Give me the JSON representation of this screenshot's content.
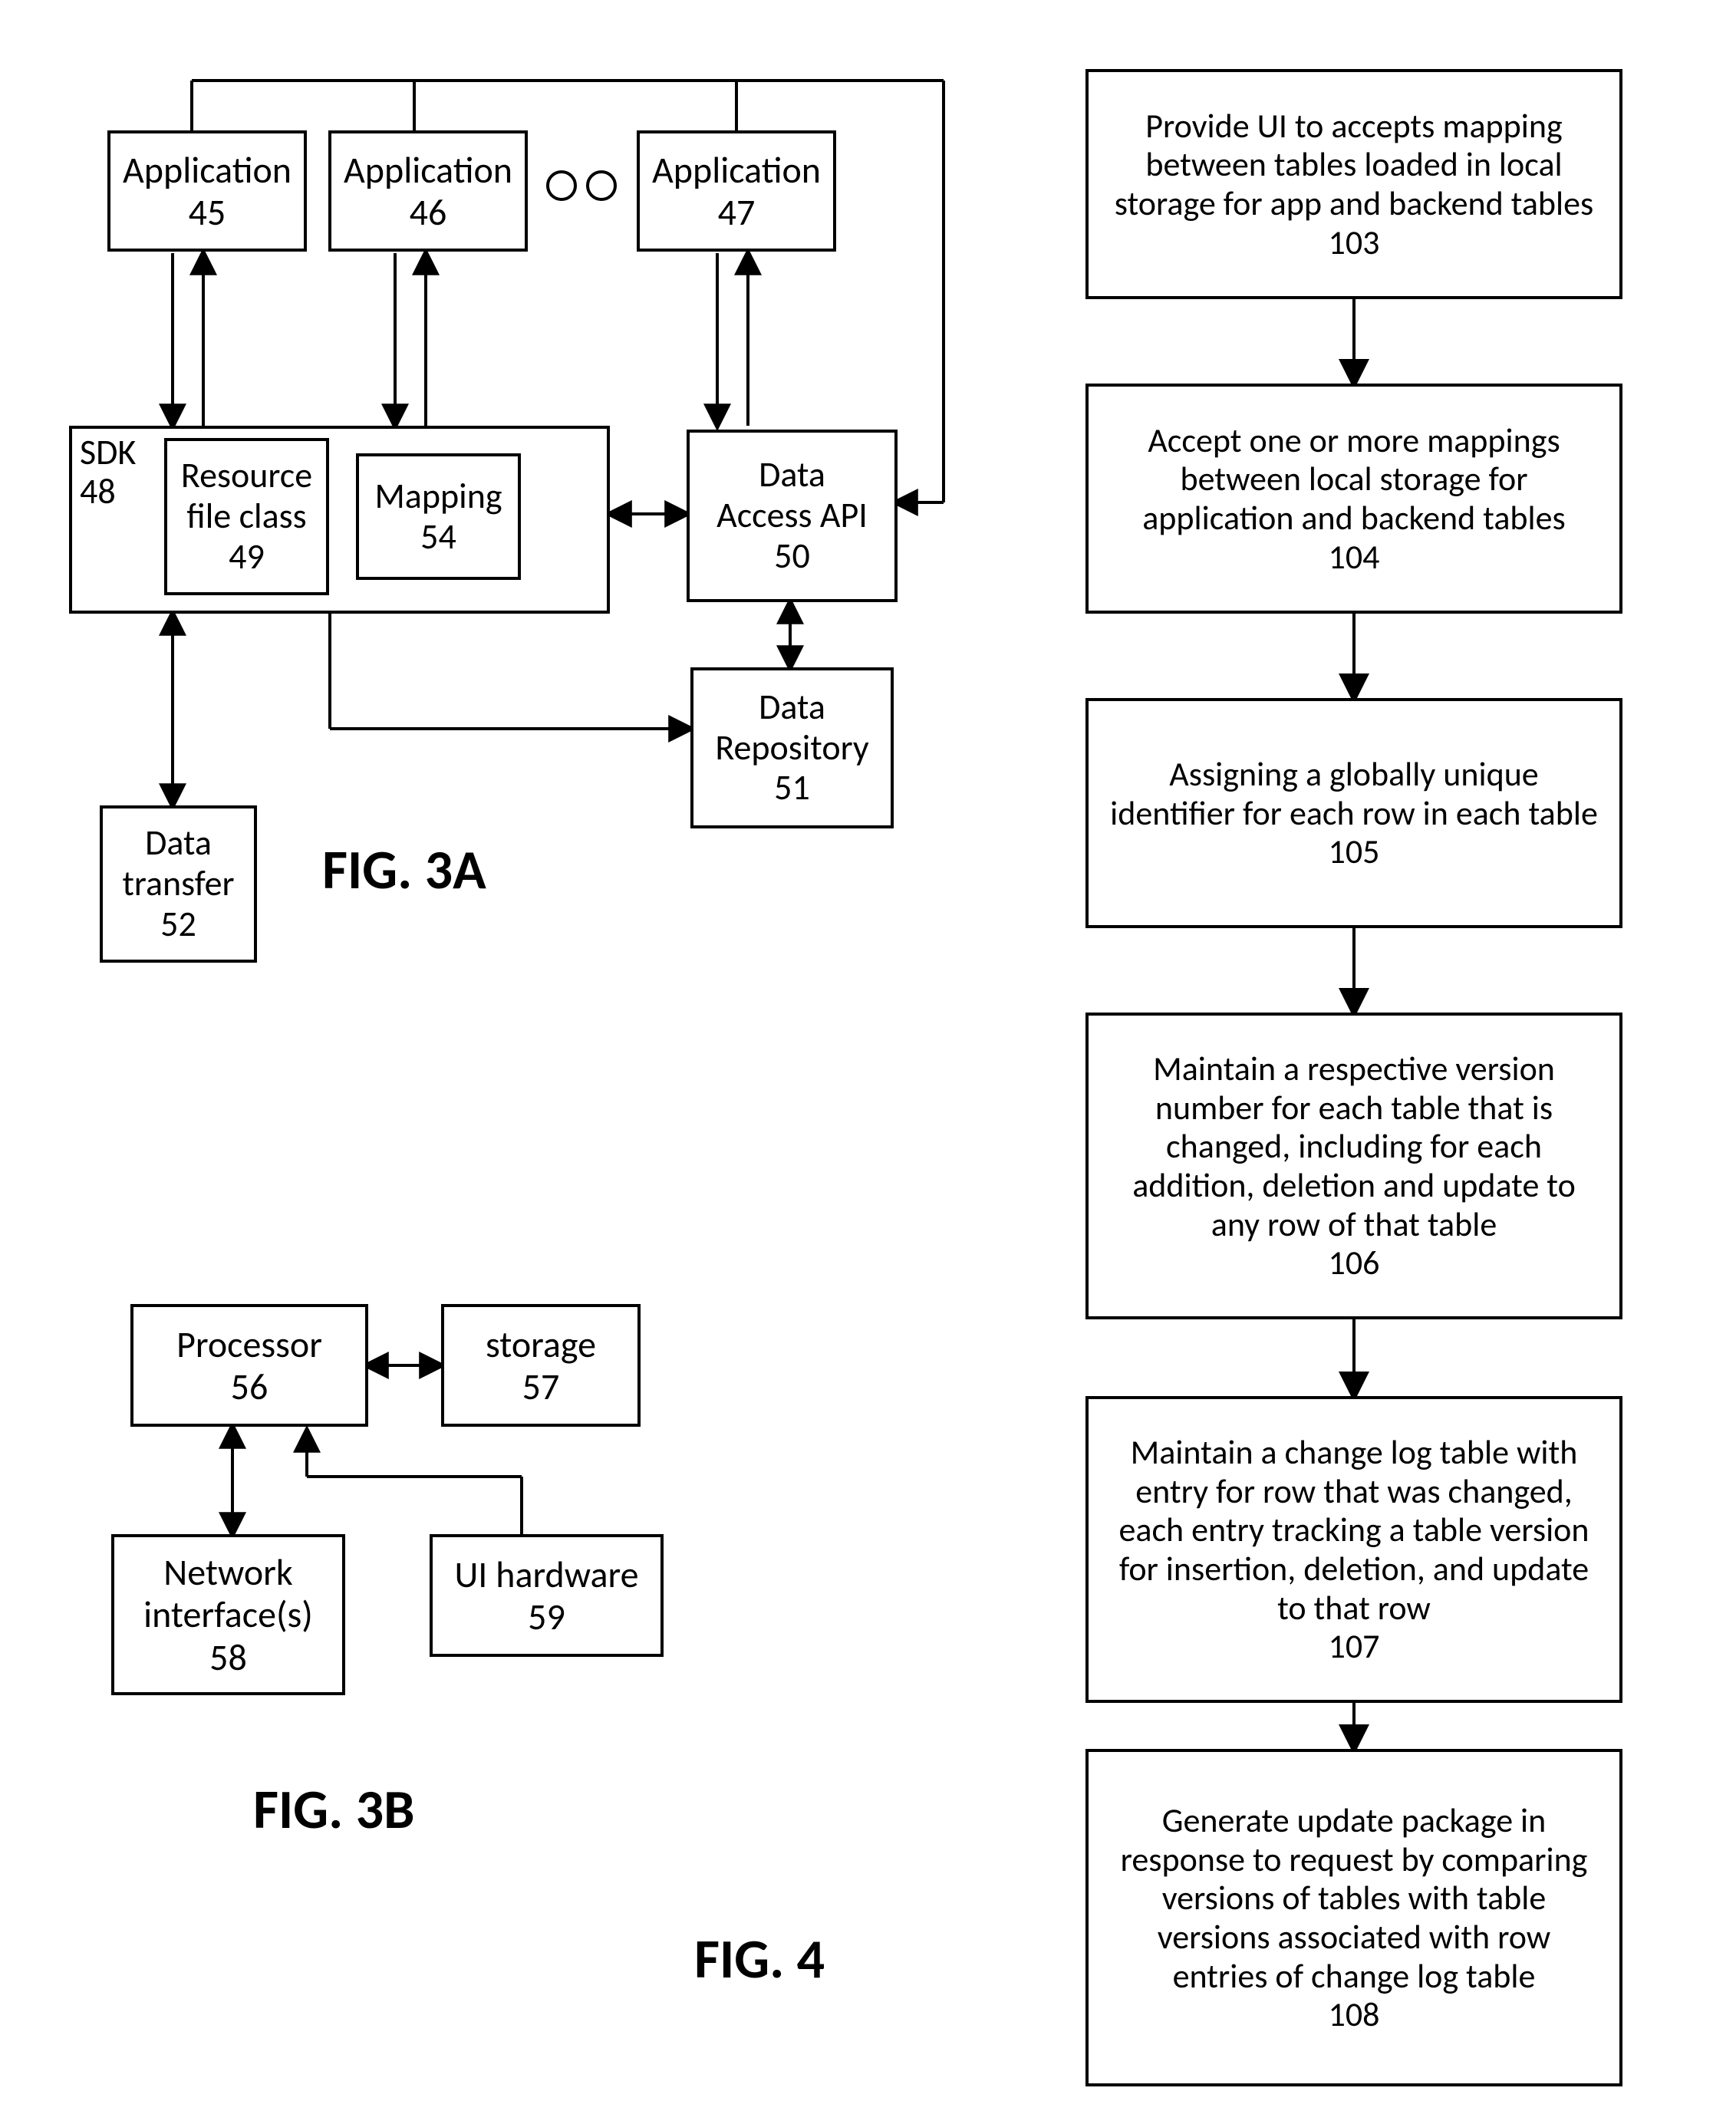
{
  "fig3a": {
    "title": "FIG. 3A",
    "app1": {
      "label": "Application",
      "num": "45"
    },
    "app2": {
      "label": "Application",
      "num": "46"
    },
    "ellipsis_name": "ellipsis-icon",
    "app3": {
      "label": "Application",
      "num": "47"
    },
    "sdk": {
      "label": "SDK",
      "num": "48"
    },
    "resource": {
      "label": "Resource\nfile class",
      "num": "49"
    },
    "mapping": {
      "label": "Mapping",
      "num": "54"
    },
    "dataAccess": {
      "label": "Data\nAccess API",
      "num": "50"
    },
    "dataRepo": {
      "label": "Data\nRepository",
      "num": "51"
    },
    "dataTransfer": {
      "label": "Data\ntransfer",
      "num": "52"
    }
  },
  "fig3b": {
    "title": "FIG. 3B",
    "processor": {
      "label": "Processor",
      "num": "56"
    },
    "storage": {
      "label": "storage",
      "num": "57"
    },
    "network": {
      "label": "Network\ninterface(s)",
      "num": "58"
    },
    "uihw": {
      "label": "UI hardware",
      "num": "59"
    }
  },
  "fig4": {
    "title": "FIG. 4",
    "s103": {
      "text": "Provide UI to accepts mapping between tables loaded in local storage for app and backend tables",
      "num": "103"
    },
    "s104": {
      "text": "Accept one or more mappings between local storage for application and backend tables",
      "num": "104"
    },
    "s105": {
      "text": "Assigning a globally unique identifier for each row in each table",
      "num": "105"
    },
    "s106": {
      "text": "Maintain a respective version number for each table that is changed, including  for each addition, deletion and update to any row of that table",
      "num": "106"
    },
    "s107": {
      "text": "Maintain a change log table with entry for row that was changed, each entry tracking a table version for insertion, deletion, and update to that row",
      "num": "107"
    },
    "s108": {
      "text": "Generate update package in response to request by comparing versions of tables with table versions associated with row entries of change log table",
      "num": "108"
    }
  }
}
